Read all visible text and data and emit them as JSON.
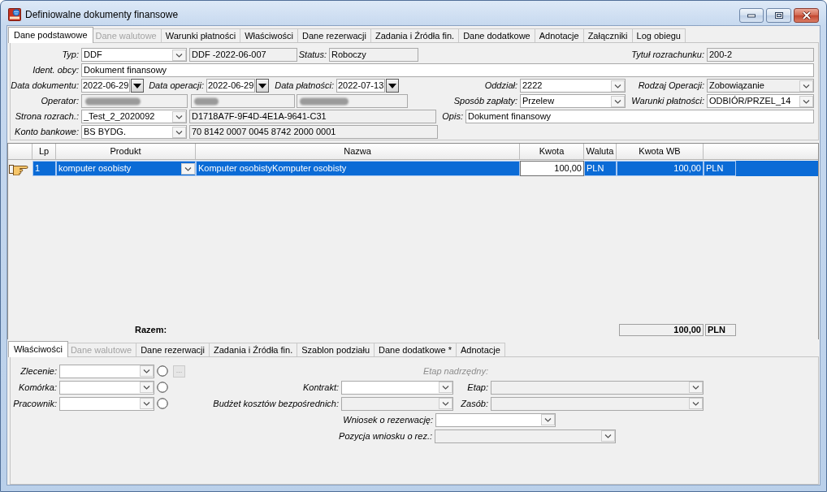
{
  "window": {
    "title": "Definiowalne dokumenty finansowe"
  },
  "tabs": [
    {
      "label": "Dane podstawowe",
      "selected": true,
      "disabled": false
    },
    {
      "label": "Dane walutowe",
      "selected": false,
      "disabled": true
    },
    {
      "label": "Warunki płatności",
      "selected": false,
      "disabled": false
    },
    {
      "label": "Właściwości",
      "selected": false,
      "disabled": false
    },
    {
      "label": "Dane rezerwacji",
      "selected": false,
      "disabled": false
    },
    {
      "label": "Zadania i Źródła fin.",
      "selected": false,
      "disabled": false
    },
    {
      "label": "Dane dodatkowe",
      "selected": false,
      "disabled": false
    },
    {
      "label": "Adnotacje",
      "selected": false,
      "disabled": false
    },
    {
      "label": "Załączniki",
      "selected": false,
      "disabled": false
    },
    {
      "label": "Log obiegu",
      "selected": false,
      "disabled": false
    }
  ],
  "header_form": {
    "rows": [
      [
        {
          "kind": "combo",
          "label": "Typ:",
          "value": "DDF",
          "disabled": false
        },
        {
          "kind": "text",
          "value": "DDF -2022-06-007",
          "disabled": true
        },
        {
          "kind": "text",
          "label": "Status:",
          "value": "Roboczy",
          "disabled": true
        },
        "",
        {
          "kind": "text",
          "label": "Tytuł rozrachunku:",
          "value": "200-2",
          "disabled": true
        }
      ],
      [
        {
          "kind": "text",
          "label": "Ident. obcy:",
          "value": "Dokument finansowy",
          "disabled": false
        }
      ],
      [
        {
          "kind": "date",
          "label": "Data dokumentu:",
          "value": "2022-06-29",
          "disabled": false
        },
        {
          "kind": "date",
          "label": "Data operacji:",
          "value": "2022-06-29",
          "disabled": false
        },
        {
          "kind": "date",
          "label": "Data płatności:",
          "value": "2022-07-13",
          "disabled": false
        },
        {
          "kind": "combo",
          "label": "Oddział:",
          "value": "2222",
          "disabled": false
        },
        {
          "kind": "combo",
          "label": "Rodzaj Operacji:",
          "value": "Zobowiązanie",
          "disabled": true
        }
      ],
      [
        {
          "kind": "masked",
          "label": "Operator:",
          "disabled": true
        },
        {
          "kind": "masked",
          "disabled": true
        },
        {
          "kind": "masked",
          "disabled": true
        },
        {
          "kind": "combo",
          "label": "Sposób zapłaty:",
          "value": "Przelew",
          "disabled": false
        },
        {
          "kind": "combo",
          "label": "Warunki płatności:",
          "value": "ODBIÓR/PRZEL_14",
          "disabled": false
        }
      ],
      [
        {
          "kind": "combo",
          "label": "Strona rozrach.:",
          "value": "_Test_2_2020092",
          "disabled": false
        },
        {
          "kind": "text",
          "value": "D1718A7F-9F4D-4E1A-9641-C31",
          "disabled": true
        },
        "",
        {
          "kind": "text",
          "label": "Opis:",
          "value": "Dokument finansowy",
          "disabled": false
        }
      ],
      [
        {
          "kind": "combo",
          "label": "Konto bankowe:",
          "value": "BS BYDG.",
          "disabled": false
        },
        {
          "kind": "text",
          "value": "70 8142 0007 0045 8742 2000 0001",
          "disabled": true
        }
      ]
    ]
  },
  "grid": {
    "columns": [
      "Lp",
      "Produkt",
      "Nazwa",
      "Kwota",
      "Waluta",
      "Kwota WB"
    ],
    "rows": [
      {
        "selected": true,
        "current": true,
        "cells": [
          {
            "kind": "text",
            "text": "1",
            "editing": false
          },
          {
            "kind": "combo",
            "text": "komputer osobisty",
            "editing": false
          },
          {
            "kind": "text",
            "text": "Komputer osobistyKomputer osobisty",
            "editing": false
          },
          {
            "kind": "number",
            "text": "100,00",
            "editing": true
          },
          {
            "kind": "text",
            "text": "PLN",
            "editing": false
          },
          {
            "kind": "number",
            "text": "100,00",
            "editing": false
          },
          {
            "kind": "text",
            "text": "PLN",
            "editing": false
          }
        ]
      }
    ]
  },
  "totals": {
    "label": "Razem:",
    "amount": "100,00",
    "currency": "PLN"
  },
  "detail_tabs": [
    {
      "label": "Właściwości",
      "selected": true,
      "disabled": false
    },
    {
      "label": "Dane walutowe",
      "selected": false,
      "disabled": true
    },
    {
      "label": "Dane rezerwacji",
      "selected": false,
      "disabled": false
    },
    {
      "label": "Zadania i Źródła fin.",
      "selected": false,
      "disabled": false
    },
    {
      "label": "Szablon podziału",
      "selected": false,
      "disabled": false
    },
    {
      "label": "Dane dodatkowe *",
      "selected": false,
      "disabled": false
    },
    {
      "label": "Adnotacje",
      "selected": false,
      "disabled": false
    }
  ],
  "detail_form": {
    "rows": [
      [
        {
          "kind": "combo",
          "label": "Zlecenie:",
          "disabled": false
        },
        {
          "kind": "radio",
          "checked": false,
          "disabled": false
        },
        {
          "kind": "button",
          "label": "...",
          "disabled": true
        },
        {
          "kind": "caption",
          "label": "Etap nadrzędny:",
          "disabled": true
        }
      ],
      [
        {
          "kind": "combo",
          "label": "Komórka:",
          "disabled": false
        },
        {
          "kind": "radio",
          "checked": false,
          "disabled": false
        },
        {
          "kind": "combo",
          "label": "Kontrakt:",
          "disabled": false
        },
        {
          "kind": "combo",
          "label": "Etap:",
          "disabled": true
        }
      ],
      [
        {
          "kind": "combo",
          "label": "Pracownik:",
          "disabled": false
        },
        {
          "kind": "radio",
          "checked": false,
          "disabled": false
        },
        {
          "kind": "combo",
          "label": "Budżet kosztów bezpośrednich:",
          "disabled": true
        },
        {
          "kind": "combo",
          "label": "Zasób:",
          "disabled": true
        }
      ],
      [
        {
          "kind": "combo",
          "label": "Wniosek o rezerwację:",
          "disabled": false
        }
      ],
      [
        {
          "kind": "combo",
          "label": "Pozycja wniosku o rez.:",
          "disabled": true
        }
      ]
    ]
  }
}
